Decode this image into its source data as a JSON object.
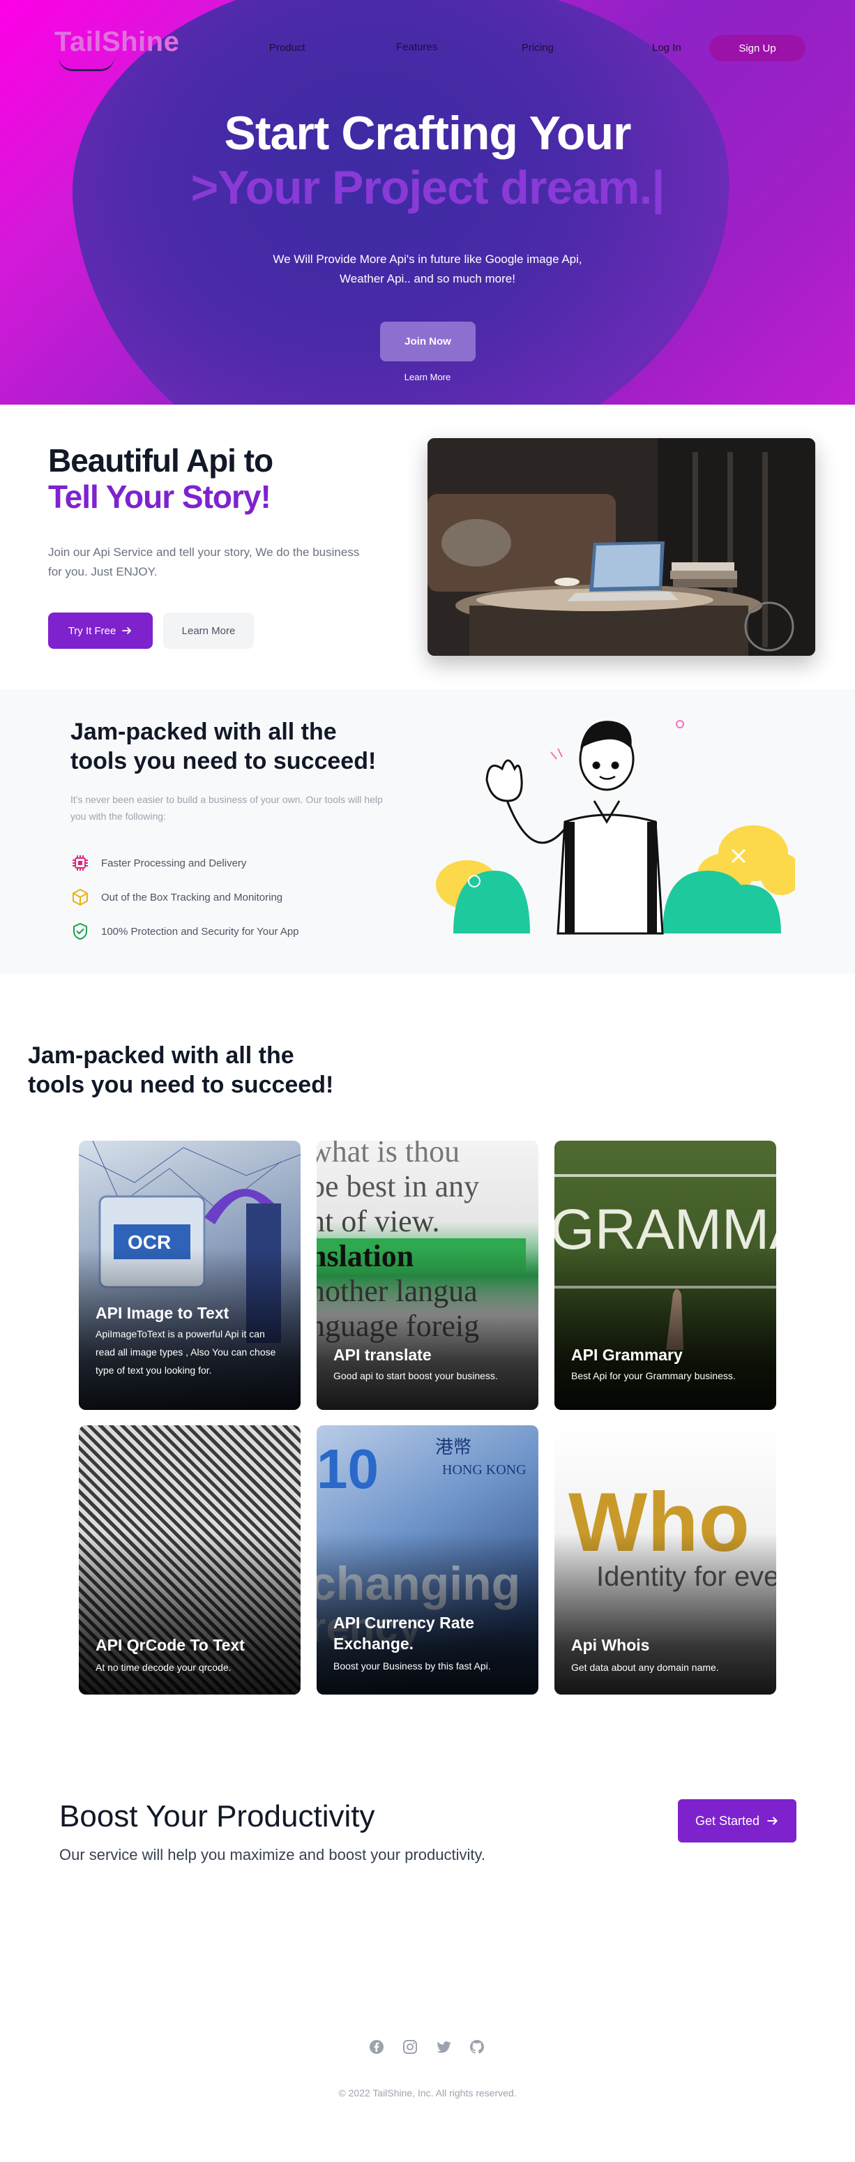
{
  "brand": {
    "name": "TailShine"
  },
  "nav": {
    "product": "Product",
    "features": "Features",
    "pricing": "Pricing",
    "login": "Log In",
    "signup": "Sign Up"
  },
  "hero": {
    "title": "Start Crafting Your",
    "typed": ">Your Project dream.|",
    "description": "We Will Provide More Api's in future like Google image Api, Weather Api.. and so much more!",
    "join_button": "Join Now",
    "learn_more": "Learn More"
  },
  "story": {
    "title_line1": "Beautiful Api to",
    "title_line2": "Tell Your Story!",
    "description": "Join our Api Service and tell your story, We do the business for you. Just ENJOY.",
    "try_button": "Try It Free",
    "learn_button": "Learn More"
  },
  "tools": {
    "title": "Jam-packed with all the tools you need to succeed!",
    "description": "It's never been easier to build a business of your own. Our tools will help you with the following:",
    "features": [
      {
        "label": "Faster Processing and Delivery",
        "icon": "chip-icon",
        "color": "#db2777"
      },
      {
        "label": "Out of the Box Tracking and Monitoring",
        "icon": "cube-icon",
        "color": "#eab308"
      },
      {
        "label": "100% Protection and Security for Your App",
        "icon": "shield-check-icon",
        "color": "#16a34a"
      }
    ]
  },
  "cards_section": {
    "title": "Jam-packed with all the tools you need to succeed!",
    "cards": [
      {
        "title": "API Image to Text",
        "description": "ApiImageToText is a powerful Api it can read all image types , Also You can chose type of text you looking for.",
        "image": "OCR"
      },
      {
        "title": "API translate",
        "description": "Good api to start boost your business.",
        "image": "translation"
      },
      {
        "title": "API Grammary",
        "description": "Best Api for your Grammary business.",
        "image": "GRAMMAR"
      },
      {
        "title": "API QrCode To Text",
        "description": "At no time decode your qrcode.",
        "image": "qr-wall"
      },
      {
        "title": "API Currency Rate Exchange.",
        "description": "Boost your Business by this fast Api.",
        "image": "changing currency"
      },
      {
        "title": "Api Whois",
        "description": "Get data about any domain name.",
        "image": "Whois Identity for every"
      }
    ]
  },
  "cta": {
    "title": "Boost Your Productivity",
    "description": "Our service will help you maximize and boost your productivity.",
    "button": "Get Started"
  },
  "footer": {
    "socials": [
      "facebook-icon",
      "instagram-icon",
      "twitter-icon",
      "github-icon"
    ],
    "copyright": "© 2022 TailShine, Inc. All rights reserved."
  },
  "colors": {
    "accent": "#7e22ce",
    "hero_pink": "#ff00e6",
    "hero_blue": "#3d2ba3"
  }
}
